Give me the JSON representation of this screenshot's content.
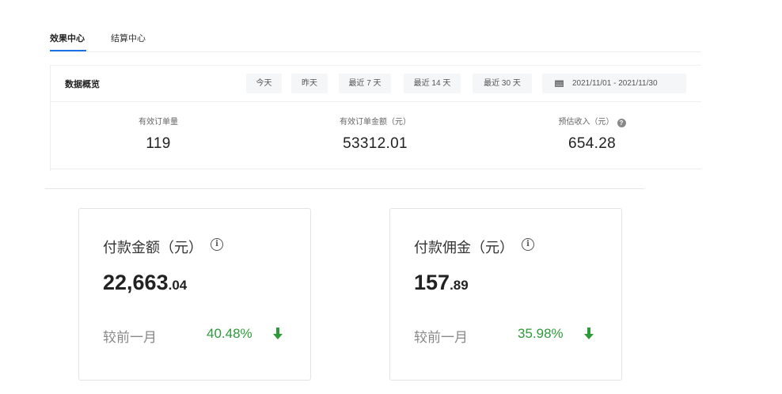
{
  "tabs": [
    {
      "label": "效果中心",
      "active": true
    },
    {
      "label": "结算中心",
      "active": false
    }
  ],
  "overview": {
    "title": "数据概览",
    "ranges": [
      "今天",
      "昨天",
      "最近 7 天",
      "最近 14 天",
      "最近 30 天"
    ],
    "date_range": "2021/11/01  -  2021/11/30",
    "metrics": [
      {
        "label": "有效订单量",
        "value": "119"
      },
      {
        "label": "有效订单金额（元）",
        "value": "53312.01"
      },
      {
        "label": "预估收入（元）",
        "value": "654.28",
        "help_icon": "question-icon"
      }
    ]
  },
  "cards": [
    {
      "title": "付款金额（元）",
      "amount_int": "22,663",
      "amount_dec": ".04",
      "compare_label": "较前一月",
      "change": "40.48%",
      "trend": "down"
    },
    {
      "title": "付款佣金（元）",
      "amount_int": "157",
      "amount_dec": ".89",
      "compare_label": "较前一月",
      "change": "35.98%",
      "trend": "down"
    }
  ],
  "colors": {
    "accent": "#1a73e8",
    "trend_green": "#2e9a3a"
  }
}
